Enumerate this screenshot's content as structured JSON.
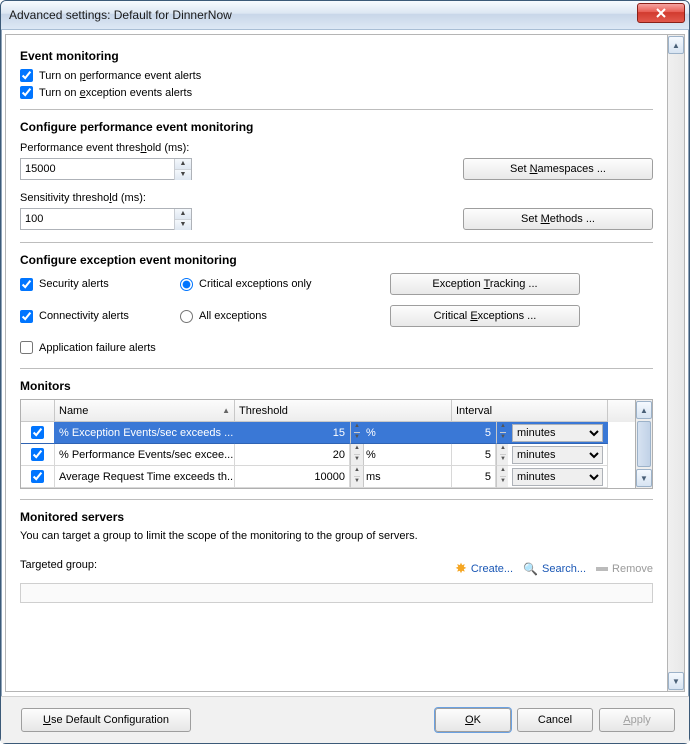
{
  "window": {
    "title": "Advanced settings: Default for DinnerNow"
  },
  "sections": {
    "event_monitoring": {
      "heading": "Event monitoring",
      "chk_perf": "Turn on performance event alerts",
      "chk_perf_key": "p",
      "chk_exc": "Turn on exception events alerts",
      "chk_exc_key": "e"
    },
    "perf_config": {
      "heading": "Configure performance event monitoring",
      "threshold_label_pre": "Performance event thres",
      "threshold_label_key": "h",
      "threshold_label_post": "old (ms):",
      "threshold_value": "15000",
      "sens_label_pre": "Sensitivity thresho",
      "sens_label_key": "l",
      "sens_label_post": "d (ms):",
      "sens_value": "100",
      "btn_namespaces_pre": "Set ",
      "btn_namespaces_key": "N",
      "btn_namespaces_post": "amespaces ...",
      "btn_methods_pre": "Set ",
      "btn_methods_key": "M",
      "btn_methods_post": "ethods ..."
    },
    "exc_config": {
      "heading": "Configure exception event monitoring",
      "chk_security": "Security alerts",
      "chk_connectivity": "Connectivity alerts",
      "chk_appfail": "Application failure alerts",
      "radio_critical": "Critical exceptions only",
      "radio_all": "All exceptions",
      "btn_tracking_pre": "Exception ",
      "btn_tracking_key": "T",
      "btn_tracking_post": "racking ...",
      "btn_critical_pre": "Critical ",
      "btn_critical_key": "E",
      "btn_critical_post": "xceptions ..."
    },
    "monitors": {
      "heading": "Monitors",
      "col_name": "Name",
      "col_threshold": "Threshold",
      "col_interval": "Interval",
      "rows": [
        {
          "checked": true,
          "name": "% Exception Events/sec exceeds ...",
          "threshold": "15",
          "unit": "%",
          "interval": "5",
          "interval_unit": "minutes",
          "selected": true
        },
        {
          "checked": true,
          "name": "% Performance Events/sec excee...",
          "threshold": "20",
          "unit": "%",
          "interval": "5",
          "interval_unit": "minutes",
          "selected": false
        },
        {
          "checked": true,
          "name": "Average Request Time exceeds th...",
          "threshold": "10000",
          "unit": "ms",
          "interval": "5",
          "interval_unit": "minutes",
          "selected": false
        }
      ]
    },
    "servers": {
      "heading": "Monitored servers",
      "desc": "You can target a group to limit the scope of the monitoring to the group of servers.",
      "label": "Targeted group:",
      "link_create": "Create...",
      "link_search": "Search...",
      "link_remove": "Remove"
    }
  },
  "footer": {
    "use_default_pre": "",
    "use_default_key": "U",
    "use_default_post": "se Default Configuration",
    "ok_key": "O",
    "ok_post": "K",
    "cancel": "Cancel",
    "apply_key": "A",
    "apply_post": "pply"
  }
}
